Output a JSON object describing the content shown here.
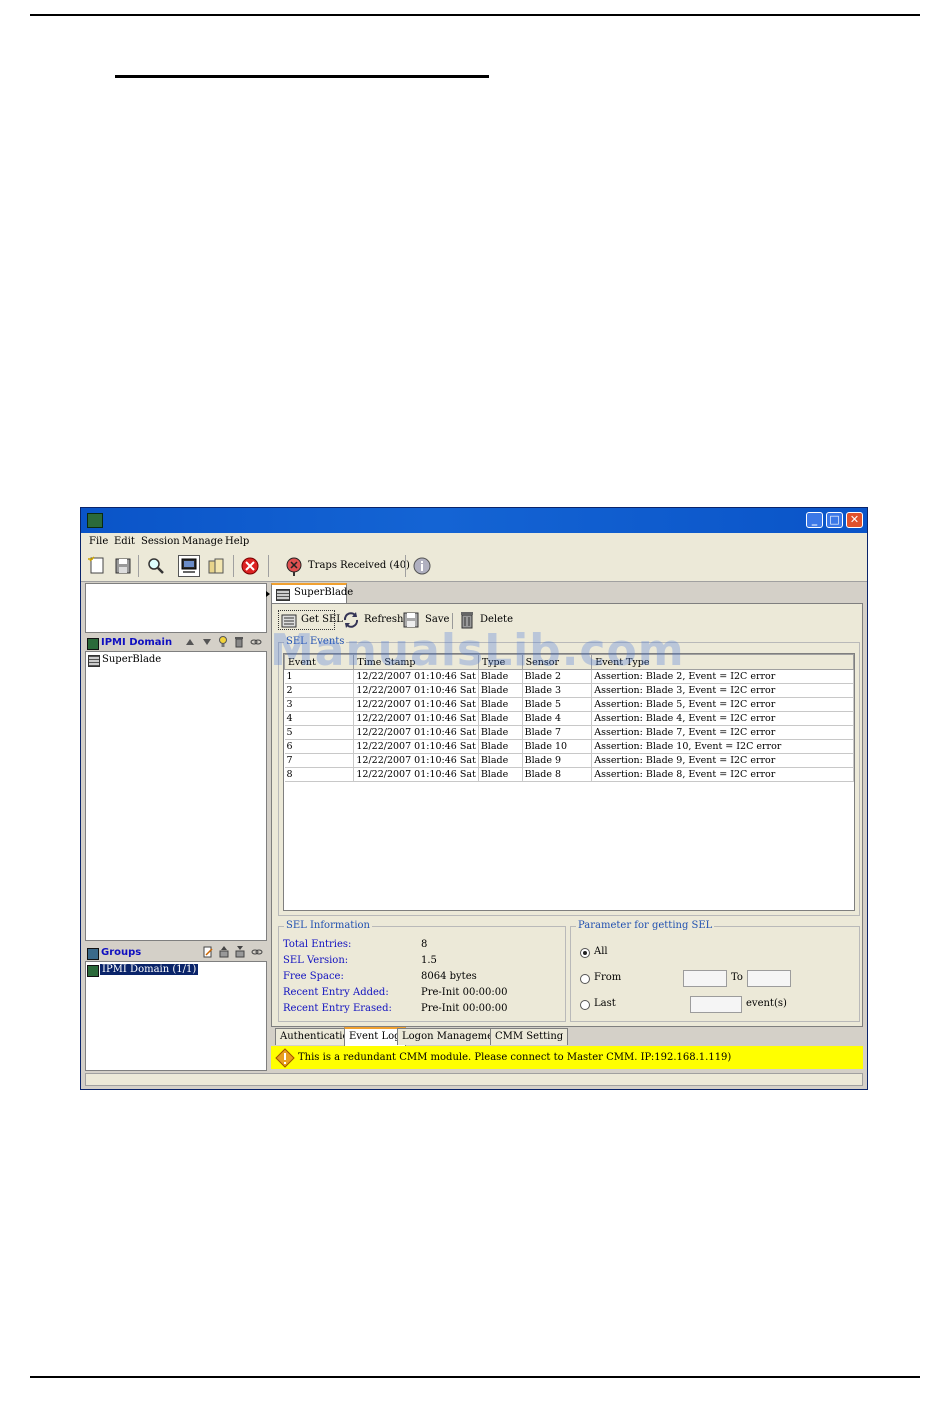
{
  "window": {
    "minimize_glyph": "_",
    "maximize_glyph": "□",
    "close_glyph": "✕"
  },
  "menu": {
    "items": [
      {
        "label": "File"
      },
      {
        "label": "Edit"
      },
      {
        "label": "Session"
      },
      {
        "label": "Manage"
      },
      {
        "label": "Help"
      }
    ]
  },
  "toolbar": {
    "traps_label": "Traps Received  (40)"
  },
  "left": {
    "ipmi_domain_title": "IPMI Domain",
    "tree_items": [
      {
        "label": "SuperBlade"
      }
    ],
    "groups_title": "Groups",
    "group_items": [
      {
        "label": "IPMI Domain (1/1)",
        "selected": true
      }
    ]
  },
  "main": {
    "top_tab": "SuperBlade",
    "actions": {
      "get_sel": "Get SEL",
      "refresh": "Refresh",
      "save": "Save",
      "delete": "Delete"
    },
    "sel_events": {
      "title": "SEL Events",
      "columns": [
        "Event",
        "Time Stamp",
        "Type",
        "Sensor",
        "Event Type"
      ],
      "rows": [
        {
          "event": "1",
          "time": "12/22/2007 01:10:46 Sat",
          "type": "Blade",
          "sensor": "Blade 2",
          "event_type": "Assertion: Blade 2, Event = I2C error"
        },
        {
          "event": "2",
          "time": "12/22/2007 01:10:46 Sat",
          "type": "Blade",
          "sensor": "Blade 3",
          "event_type": "Assertion: Blade 3, Event = I2C error"
        },
        {
          "event": "3",
          "time": "12/22/2007 01:10:46 Sat",
          "type": "Blade",
          "sensor": "Blade 5",
          "event_type": "Assertion: Blade 5, Event = I2C error"
        },
        {
          "event": "4",
          "time": "12/22/2007 01:10:46 Sat",
          "type": "Blade",
          "sensor": "Blade 4",
          "event_type": "Assertion: Blade 4, Event = I2C error"
        },
        {
          "event": "5",
          "time": "12/22/2007 01:10:46 Sat",
          "type": "Blade",
          "sensor": "Blade 7",
          "event_type": "Assertion: Blade 7, Event = I2C error"
        },
        {
          "event": "6",
          "time": "12/22/2007 01:10:46 Sat",
          "type": "Blade",
          "sensor": "Blade 10",
          "event_type": "Assertion: Blade 10, Event = I2C error"
        },
        {
          "event": "7",
          "time": "12/22/2007 01:10:46 Sat",
          "type": "Blade",
          "sensor": "Blade 9",
          "event_type": "Assertion: Blade 9, Event = I2C error"
        },
        {
          "event": "8",
          "time": "12/22/2007 01:10:46 Sat",
          "type": "Blade",
          "sensor": "Blade 8",
          "event_type": "Assertion: Blade 8, Event = I2C error"
        }
      ]
    },
    "sel_info": {
      "title": "SEL Information",
      "total_entries_label": "Total Entries:",
      "total_entries_value": "8",
      "sel_version_label": "SEL Version:",
      "sel_version_value": "1.5",
      "free_space_label": "Free Space:",
      "free_space_value": "8064 bytes",
      "recent_added_label": "Recent Entry Added:",
      "recent_added_value": "Pre-Init 00:00:00",
      "recent_erased_label": "Recent Entry Erased:",
      "recent_erased_value": "Pre-Init 00:00:00"
    },
    "params": {
      "title": "Parameter for getting SEL",
      "all_label": "All",
      "from_label": "From",
      "to_label": "To",
      "last_label": "Last",
      "events_suffix": "event(s)",
      "from_value": "",
      "to_value": "",
      "last_value": "",
      "selected": "All"
    },
    "bottom_tabs": [
      {
        "label": "Authentication"
      },
      {
        "label": "Event Log",
        "active": true
      },
      {
        "label": "Logon Management"
      },
      {
        "label": "CMM Setting"
      }
    ],
    "status_message": "This is a redundant CMM module. Please connect to Master CMM.  IP:192.168.1.119)"
  },
  "watermark": "ManualsLib.com",
  "colors": {
    "title_blue": "#0a54c8",
    "panel_title": "#1010c0",
    "group_label": "#2050b0",
    "status_yellow": "#ffff00",
    "selection": "#0a246a"
  }
}
